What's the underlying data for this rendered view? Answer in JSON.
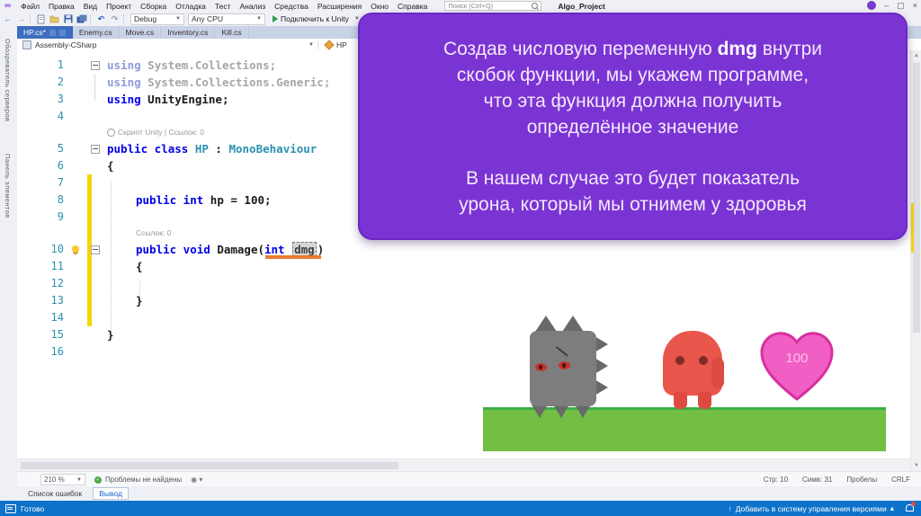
{
  "window": {
    "title": "Algo_Project",
    "search_placeholder": "Поиск (Ctrl+Q)",
    "minimize": "–",
    "maximize": "▢",
    "close": "×"
  },
  "menu": {
    "items": [
      "Файл",
      "Правка",
      "Вид",
      "Проект",
      "Сборка",
      "Отладка",
      "Тест",
      "Анализ",
      "Средства",
      "Расширения",
      "Окно",
      "Справка"
    ]
  },
  "toolbar": {
    "configuration": "Debug",
    "platform": "Any CPU",
    "run_label": "Подключить к Unity",
    "undo_glyph": "↶",
    "redo_glyph": "↷",
    "back_glyph": "←",
    "forward_glyph": "→"
  },
  "side_rail": {
    "tabs": [
      "Обозреватель серверов",
      "Панель элементов"
    ]
  },
  "document_tabs": [
    {
      "label": "HP.cs*",
      "active": true
    },
    {
      "label": "Enemy.cs",
      "active": false
    },
    {
      "label": "Move.cs",
      "active": false
    },
    {
      "label": "Inventory.cs",
      "active": false
    },
    {
      "label": "Kill.cs",
      "active": false
    }
  ],
  "navbar": {
    "project": "Assembly-CSharp",
    "member": "HP"
  },
  "editor": {
    "lines": [
      {
        "n": 1,
        "fold": true,
        "ind": 0,
        "tok": [
          [
            "kwdim",
            "using"
          ],
          [
            "dim",
            " System.Collections;"
          ]
        ]
      },
      {
        "n": 2,
        "ind": 0,
        "tok": [
          [
            "kwdim",
            "using"
          ],
          [
            "dim",
            " System.Collections.Generic;"
          ]
        ]
      },
      {
        "n": 3,
        "ind": 0,
        "tok": [
          [
            "kw",
            "using"
          ],
          [
            "plain",
            " UnityEngine;"
          ]
        ]
      },
      {
        "n": 4,
        "ind": 0,
        "tok": []
      },
      {
        "lens": "Скрипт Unity | Ссылок: 0",
        "gear": true,
        "ind": 0
      },
      {
        "n": 5,
        "fold": true,
        "ind": 0,
        "tok": [
          [
            "kw",
            "public class "
          ],
          [
            "type",
            "HP"
          ],
          [
            "plain",
            " : "
          ],
          [
            "type",
            "MonoBehaviour"
          ]
        ]
      },
      {
        "n": 6,
        "ind": 0,
        "tok": [
          [
            "plain",
            "{"
          ]
        ]
      },
      {
        "n": 7,
        "ind": 0,
        "tok": []
      },
      {
        "n": 8,
        "ind": 1,
        "tok": [
          [
            "kw",
            "public int "
          ],
          [
            "plain",
            "hp = 100;"
          ]
        ]
      },
      {
        "n": 9,
        "ind": 0,
        "tok": []
      },
      {
        "lens": "Ссылок: 0",
        "gear": false,
        "ind": 1
      },
      {
        "n": 10,
        "fold": true,
        "bulb": true,
        "underline": true,
        "ind": 1,
        "tok": [
          [
            "kw",
            "public void "
          ],
          [
            "plain",
            "Damage("
          ],
          [
            "kw",
            "int"
          ],
          [
            "plain",
            " "
          ],
          [
            "sel",
            "dmg"
          ],
          [
            "plain",
            ")"
          ]
        ]
      },
      {
        "n": 11,
        "ind": 1,
        "tok": [
          [
            "plain",
            "{"
          ]
        ]
      },
      {
        "n": 12,
        "ind": 0,
        "tok": []
      },
      {
        "n": 13,
        "ind": 1,
        "tok": [
          [
            "plain",
            "}"
          ]
        ]
      },
      {
        "n": 14,
        "ind": 0,
        "tok": []
      },
      {
        "n": 15,
        "ind": 0,
        "tok": [
          [
            "plain",
            "}"
          ]
        ]
      },
      {
        "n": 16,
        "ind": 0,
        "tok": []
      }
    ]
  },
  "overlay": {
    "line1_pre": "Создав числовую переменную ",
    "line1_bold": "dmg",
    "line1_post": " внутри",
    "line2": "скобок функции, мы укажем программе,",
    "line3": "что эта функция должна получить",
    "line4": "определённое значение",
    "line5": "В нашем случае это будет показатель",
    "line6": "урона, который мы отнимем у здоровья",
    "background": "#7b34d4"
  },
  "game": {
    "heart_value": "100",
    "ground_color": "#72bf44",
    "heart_color": "#f15fc4"
  },
  "editor_statusbar": {
    "zoom": "210 %",
    "health": "Проблемы не найдены",
    "line": "Стр: 10",
    "column": "Симв: 31",
    "spaces": "Пробелы",
    "line_ending": "CRLF"
  },
  "panel_tabs": [
    {
      "label": "Список ошибок",
      "active": false
    },
    {
      "label": "Вывод",
      "active": true
    }
  ],
  "statusbar": {
    "ready": "Готово",
    "source_control": "Добавить в систему управления версиями",
    "source_control_arrow": "↑",
    "source_control_caret": "▴"
  },
  "colors": {
    "accent_blue": "#0d72c9",
    "active_tab": "#3d6dbe",
    "overlay_purple": "#7b34d4",
    "change_bar_yellow": "#f5d40a",
    "rename_underline_orange": "#e87d33"
  }
}
